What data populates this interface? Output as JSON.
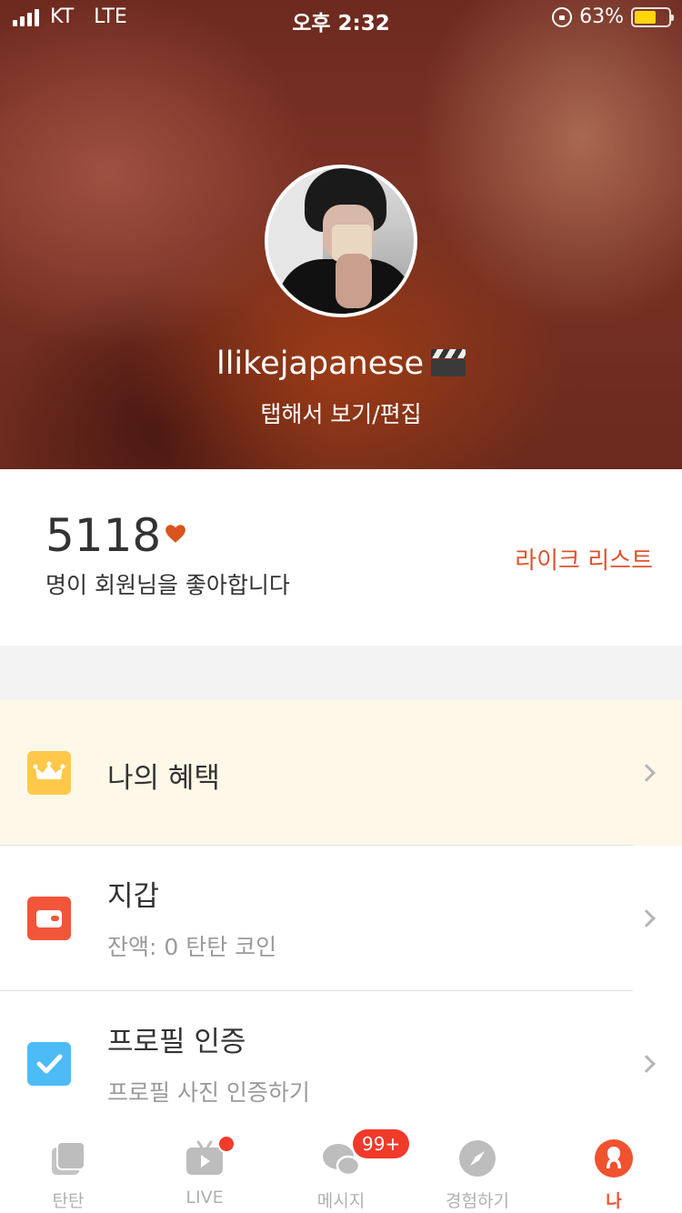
{
  "status_bar": {
    "carrier": "KT",
    "network": "LTE",
    "time": "오후 2:32",
    "battery_percent": "63%",
    "battery_level": 0.63
  },
  "profile": {
    "username": "llikejapanese",
    "username_emoji_icon": "clapper-board-icon",
    "edit_link": "탭해서 보기/편집"
  },
  "likes": {
    "count": "5118",
    "description": "명이 회원님을 좋아합니다",
    "like_list_label": "라이크 리스트",
    "accent_color": "#e0522d"
  },
  "menu": {
    "benefit": {
      "title": "나의 혜택",
      "icon": "crown-icon"
    },
    "wallet": {
      "title": "지갑",
      "subtitle": "잔액: 0 탄탄 코인",
      "icon": "wallet-icon"
    },
    "verify": {
      "title": "프로필 인증",
      "subtitle": "프로필 사진 인증하기",
      "icon": "check-icon"
    }
  },
  "tabbar": {
    "tabs": [
      {
        "label": "탄탄",
        "icon": "cards-icon"
      },
      {
        "label": "LIVE",
        "icon": "tv-play-icon"
      },
      {
        "label": "메시지",
        "icon": "chat-bubbles-icon"
      },
      {
        "label": "경험하기",
        "icon": "compass-icon"
      },
      {
        "label": "나",
        "icon": "person-icon",
        "active": true
      }
    ],
    "message_badge": "99+",
    "active_color": "#f0522f"
  }
}
